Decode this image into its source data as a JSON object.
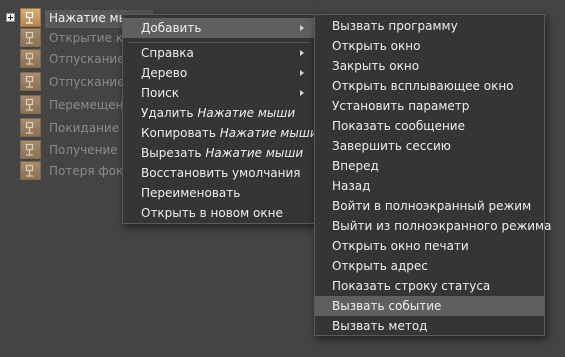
{
  "tree": {
    "items": [
      {
        "label": "Нажатие мыши",
        "state": "selected"
      },
      {
        "label": "Открытие ко",
        "state": "inactive"
      },
      {
        "label": "Отпускание к",
        "state": "inactive"
      },
      {
        "label": "Отпускание м",
        "state": "inactive"
      },
      {
        "label": "Перемещени",
        "state": "inactive"
      },
      {
        "label": "Покидание м",
        "state": "inactive"
      },
      {
        "label": "Получение ф",
        "state": "inactive"
      },
      {
        "label": "Потеря фокус",
        "state": "inactive"
      }
    ]
  },
  "context_menu": {
    "add": "Добавить",
    "help": "Справка",
    "tree": "Дерево",
    "search": "Поиск",
    "delete_prefix": "Удалить",
    "delete_target": "Нажатие мыши",
    "copy_prefix": "Копировать",
    "copy_target": "Нажатие мыши",
    "cut_prefix": "Вырезать",
    "cut_target": "Нажатие мыши",
    "restore_defaults": "Восстановить умолчания",
    "rename": "Переименовать",
    "open_new_window": "Открыть в новом окне"
  },
  "submenu": {
    "items": [
      "Вызвать программу",
      "Открыть окно",
      "Закрыть окно",
      "Открыть всплывающее окно",
      "Установить параметр",
      "Показать сообщение",
      "Завершить сессию",
      "Вперед",
      "Назад",
      "Войти в полноэкранный режим",
      "Выйти из полноэкранного режима",
      "Открыть окно печати",
      "Открыть адрес",
      "Показать строку статуса",
      "Вызвать событие",
      "Вызвать метод"
    ],
    "highlighted_index": 14
  }
}
